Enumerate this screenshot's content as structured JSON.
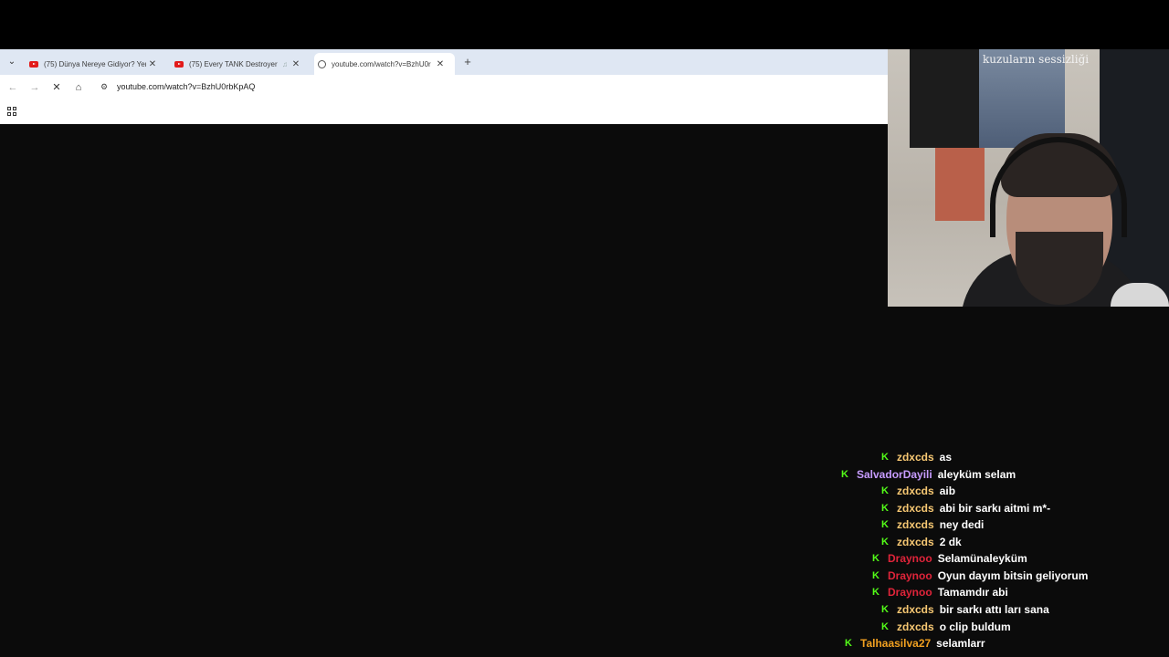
{
  "browser": {
    "tabs": [
      {
        "title": "(75) Dünya Nereye Gidiyor? Yer",
        "favicon": "youtube-icon",
        "active": false
      },
      {
        "title": "(75) Every TANK Destroyer",
        "favicon": "youtube-icon",
        "active": false,
        "audio": true
      },
      {
        "title": "youtube.com/watch?v=BzhU0r",
        "favicon": "globe-icon",
        "active": true
      }
    ],
    "new_tab_label": "+",
    "url": "youtube.com/watch?v=BzhU0rbKpAQ"
  },
  "webcam": {
    "poster_title": "kuzuların sessizliği"
  },
  "chat": {
    "colors": {
      "badge": "#53fc18"
    },
    "messages": [
      {
        "user": "zdxcds",
        "color": "#f7c873",
        "text": "as"
      },
      {
        "user": "SalvadorDayili",
        "color": "#c79cff",
        "text": "aleyküm selam"
      },
      {
        "user": "zdxcds",
        "color": "#f7c873",
        "text": "aib"
      },
      {
        "user": "zdxcds",
        "color": "#f7c873",
        "text": "abi bir sarkı aitmi m*-"
      },
      {
        "user": "zdxcds",
        "color": "#f7c873",
        "text": "ney dedi"
      },
      {
        "user": "zdxcds",
        "color": "#f7c873",
        "text": "2 dk"
      },
      {
        "user": "Draynoo",
        "color": "#e0243a",
        "text": "Selamünaleyküm"
      },
      {
        "user": "Draynoo",
        "color": "#e0243a",
        "text": "Oyun dayım bitsin geliyorum"
      },
      {
        "user": "Draynoo",
        "color": "#e0243a",
        "text": "Tamamdır abi"
      },
      {
        "user": "zdxcds",
        "color": "#f7c873",
        "text": "bir sarkı attı ları sana"
      },
      {
        "user": "zdxcds",
        "color": "#f7c873",
        "text": "o clip buldum"
      },
      {
        "user": "Talhaasilva27",
        "color": "#f0a020",
        "text": "selamlarr"
      }
    ]
  }
}
